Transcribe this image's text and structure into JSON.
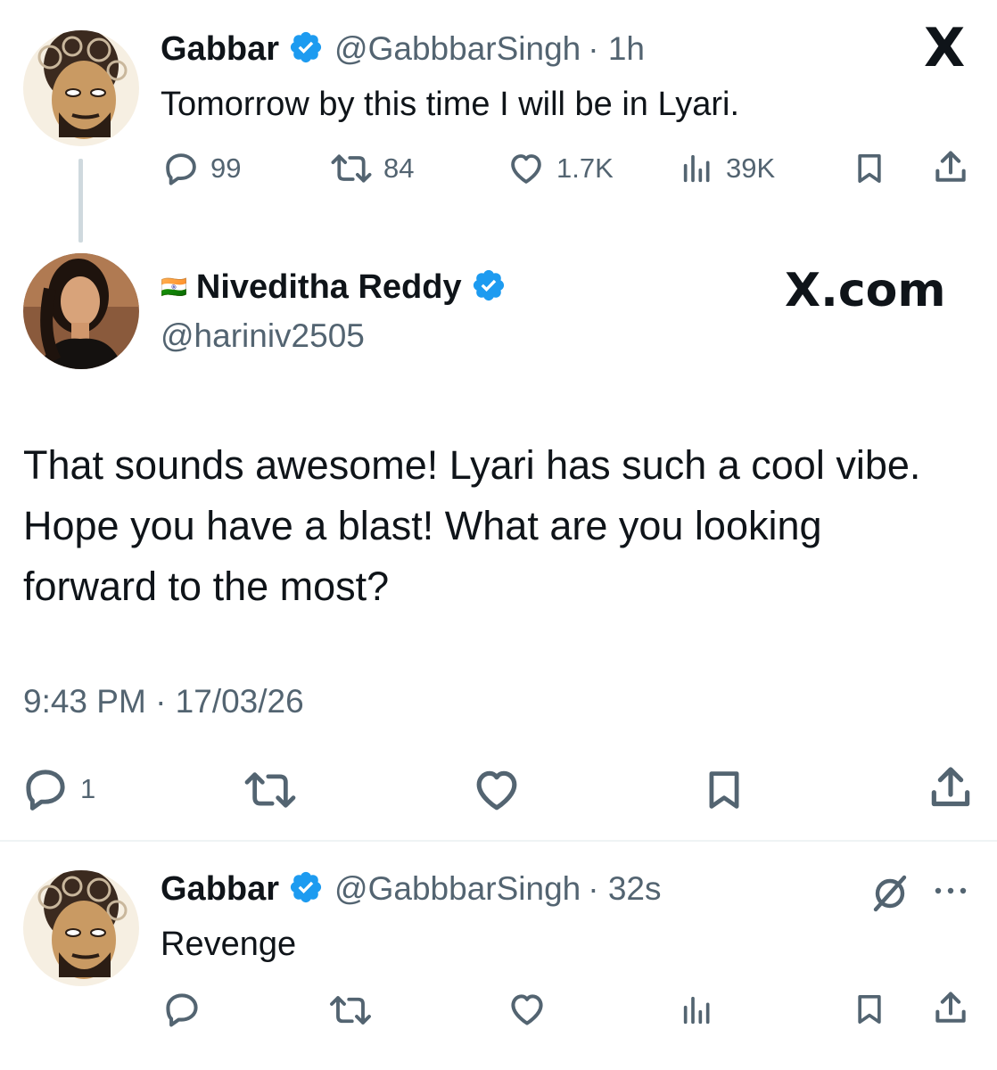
{
  "thread": {
    "parent": {
      "display_name": "Gabbar",
      "handle": "@GabbbarSingh",
      "time": "· 1h",
      "text": "Tomorrow by this time I will be in Lyari.",
      "stats": {
        "replies": "99",
        "reposts": "84",
        "likes": "1.7K",
        "views": "39K"
      }
    },
    "main": {
      "flag": "🇮🇳",
      "display_name": "Niveditha Reddy",
      "handle": "@hariniv2505",
      "text": "That sounds awesome! Lyari has such a cool vibe. Hope you have a blast! What are you looking forward to the most?",
      "timestamp": "9:43 PM · 17/03/26",
      "stats": {
        "replies": "1"
      }
    },
    "reply": {
      "display_name": "Gabbar",
      "handle": "@GabbbarSingh",
      "time": "· 32s",
      "text": "Revenge"
    }
  },
  "branding": {
    "x_logo": "X",
    "x_com": "X.com"
  },
  "colors": {
    "verified": "#1d9bf0",
    "muted": "#536471",
    "text": "#0f1419",
    "divider": "#eff3f4"
  },
  "icons": [
    "reply-icon",
    "repost-icon",
    "like-icon",
    "views-icon",
    "bookmark-icon",
    "share-icon",
    "verified-badge-icon",
    "grok-icon",
    "more-icon"
  ]
}
